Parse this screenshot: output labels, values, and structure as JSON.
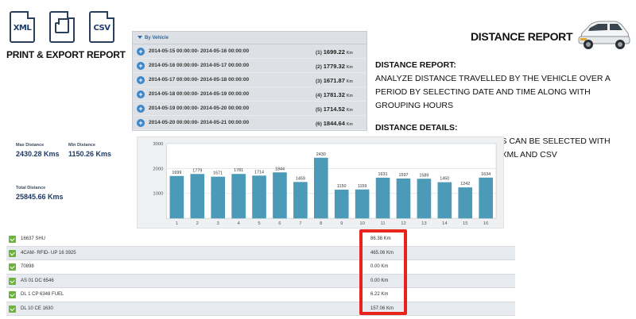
{
  "export": {
    "icons": [
      {
        "icon": "xml-file-icon",
        "label": "XML"
      },
      {
        "icon": "printer-file-icon",
        "label": ""
      },
      {
        "icon": "csv-file-icon",
        "label": "CSV"
      }
    ],
    "title": "PRINT & EXPORT REPORT"
  },
  "panel": {
    "header": "By Vehicle",
    "ranges": [
      {
        "range": "2014-05-15 00:00:00-  2014-05-16 00:00:00",
        "index": "(1)",
        "distance": "1699.22",
        "unit": "Km"
      },
      {
        "range": "2014-05-16 00:00:00-  2014-05-17 00:00:00",
        "index": "(2)",
        "distance": "1779.32",
        "unit": "Km"
      },
      {
        "range": "2014-05-17 00:00:00-  2014-05-18 00:00:00",
        "index": "(3)",
        "distance": "1671.87",
        "unit": "Km"
      },
      {
        "range": "2014-05-18 00:00:00-  2014-05-19 00:00:00",
        "index": "(4)",
        "distance": "1781.32",
        "unit": "Km"
      },
      {
        "range": "2014-05-19 00:00:00-  2014-05-20 00:00:00",
        "index": "(5)",
        "distance": "1714.52",
        "unit": "Km"
      },
      {
        "range": "2014-05-20 00:00:00-  2014-05-21 00:00:00",
        "index": "(6)",
        "distance": "1844.64",
        "unit": "Km"
      }
    ]
  },
  "report": {
    "title": "DISTANCE REPORT",
    "desc1_heading": "DISTANCE REPORT:",
    "desc1_body": "ANALYZE DISTANCE TRAVELLED BY THE VEHICLE OVER A PERIOD BY SELECTING DATE AND TIME ALONG WITH GROUPING HOURS",
    "desc2_heading": "DISTANCE DETAILS:",
    "desc2_body": "SINGLE OR MULTIPLE VEHICLES CAN BE SELECTED WITH DOWNLOADABLE REPORTS IN XML AND CSV"
  },
  "stats": {
    "max_label": "Max Distance",
    "max_value": "2430.28 Kms",
    "min_label": "Min Distance",
    "min_value": "1150.26 Kms",
    "total_label": "Total Distance",
    "total_value": "25845.66 Kms"
  },
  "chart_data": {
    "type": "bar",
    "categories": [
      "1",
      "2",
      "3",
      "4",
      "5",
      "6",
      "7",
      "8",
      "9",
      "10",
      "11",
      "12",
      "13",
      "14",
      "15",
      "16"
    ],
    "values": [
      1699,
      1779,
      1671,
      1781,
      1714,
      1844,
      1459,
      2430,
      1150,
      1159,
      1631,
      1597,
      1589,
      1450,
      1242,
      1634
    ],
    "ylim": [
      0,
      3000
    ],
    "yticks": [
      1000,
      2000,
      3000
    ],
    "grid": true,
    "bar_color": "#4a9ab8"
  },
  "vehicles": [
    {
      "name": "16637 SHU",
      "distance": "86.38 Km"
    },
    {
      "name": "4CAM- RFID- UP 16 3925",
      "distance": "465.06 Km"
    },
    {
      "name": "70898",
      "distance": "0.00 Km"
    },
    {
      "name": "AS 01 DC 6546",
      "distance": "0.00 Km"
    },
    {
      "name": "DL 1 CP 6348 FUEL",
      "distance": "6.22 Km"
    },
    {
      "name": "DL 10 CE 1630",
      "distance": "157.06 Km"
    }
  ],
  "colors": {
    "highlight": "#e8231b",
    "checkbox": "#6cb33e",
    "accent": "#3a86c8"
  }
}
